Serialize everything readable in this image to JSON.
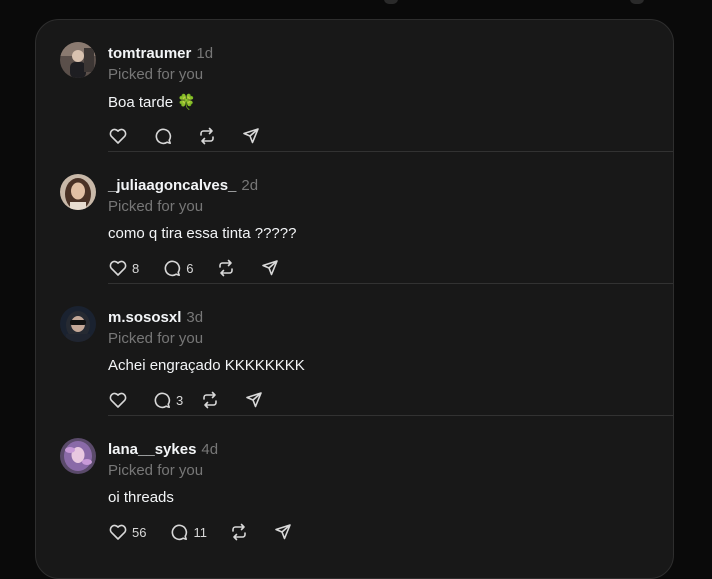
{
  "colors": {
    "background": "#0a0a0a",
    "card": "#181818",
    "text_primary": "#f3f5f7",
    "text_secondary": "#777777",
    "divider": "#323232"
  },
  "posts": [
    {
      "username": "tomtraumer",
      "time": "1d",
      "subtitle": "Picked for you",
      "text": "Boa tarde",
      "emoji": "🍀",
      "likes": "",
      "replies": "",
      "avatar_icon": "profile-photo-avatar"
    },
    {
      "username": "_juliaagoncalves_",
      "time": "2d",
      "subtitle": "Picked for you",
      "text": "como q tira essa tinta ?????",
      "emoji": "",
      "likes": "8",
      "replies": "6",
      "avatar_icon": "profile-photo-avatar"
    },
    {
      "username": "m.sososxl",
      "time": "3d",
      "subtitle": "Picked for you",
      "text": "Achei engraçado KKKKKKKK",
      "emoji": "",
      "likes": "",
      "replies": "3",
      "avatar_icon": "profile-photo-avatar"
    },
    {
      "username": "lana__sykes",
      "time": "4d",
      "subtitle": "Picked for you",
      "text": "oi threads",
      "emoji": "",
      "likes": "56",
      "replies": "11",
      "avatar_icon": "profile-photo-avatar"
    }
  ],
  "action_icons": [
    "heart-icon",
    "comment-icon",
    "repost-icon",
    "share-icon"
  ]
}
